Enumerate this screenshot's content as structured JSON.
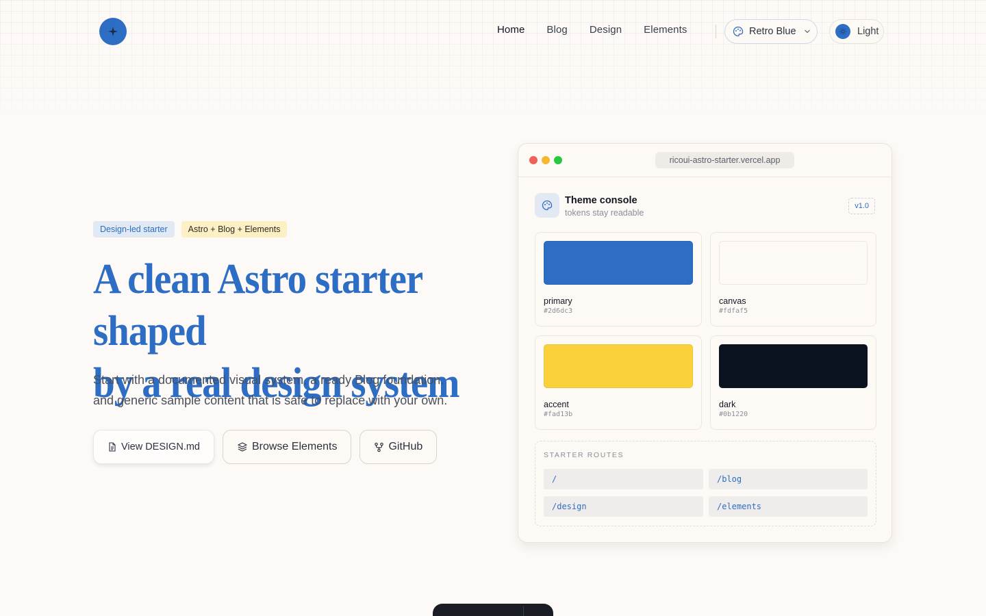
{
  "header": {
    "logo_icon": "sparkle-icon",
    "nav": [
      {
        "label": "Home",
        "active": true
      },
      {
        "label": "Blog",
        "active": false
      },
      {
        "label": "Design",
        "active": false
      },
      {
        "label": "Elements",
        "active": false
      }
    ],
    "theme_select": {
      "value": "Retro Blue",
      "icon": "palette-icon"
    },
    "mode_toggle": {
      "label": "Light"
    }
  },
  "hero": {
    "badges": [
      "Design-led starter",
      "Astro + Blog + Elements"
    ],
    "title_line1": "A clean Astro starter shaped",
    "title_line2": "by a real design system",
    "subtitle_line1": "Start with a documented visual system, a ready Blog foundation,",
    "subtitle_line2": "and generic sample content that is safe to replace with your own.",
    "buttons": [
      {
        "label": "View DESIGN.md",
        "icon": "file-icon"
      },
      {
        "label": "Browse Elements",
        "icon": "layers-icon"
      },
      {
        "label": "GitHub",
        "icon": "git-fork-icon"
      }
    ]
  },
  "console": {
    "url": "ricoui-astro-starter.vercel.app",
    "title": "Theme console",
    "subtitle": "tokens stay readable",
    "version": "v1.0",
    "swatches": [
      {
        "name": "primary",
        "hex": "#2d6dc3"
      },
      {
        "name": "canvas",
        "hex": "#fdfaf5"
      },
      {
        "name": "accent",
        "hex": "#fad13b"
      },
      {
        "name": "dark",
        "hex": "#0b1220"
      }
    ],
    "routes_label": "STARTER ROUTES",
    "routes": [
      "/",
      "/blog",
      "/design",
      "/elements"
    ]
  },
  "colors": {
    "primary": "#2d6dc3",
    "canvas": "#fdfaf5",
    "accent": "#fad13b",
    "dark": "#0b1220"
  }
}
